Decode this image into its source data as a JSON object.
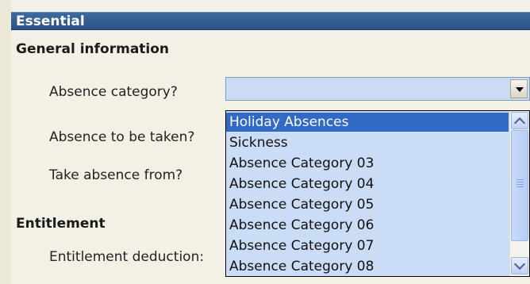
{
  "section": {
    "title": "Essential"
  },
  "general": {
    "heading": "General information",
    "fields": [
      {
        "label": "Absence category?"
      },
      {
        "label": "Absence to be taken?"
      },
      {
        "label": "Take absence from?"
      }
    ]
  },
  "entitlement": {
    "heading": "Entitlement",
    "fields": [
      {
        "label": "Entitlement deduction:"
      }
    ]
  },
  "absence_category_combo": {
    "value": "",
    "dropdown_open": true,
    "icon": "chevron-down-icon",
    "options": [
      {
        "label": "Holiday Absences",
        "selected": true
      },
      {
        "label": "Sickness",
        "selected": false
      },
      {
        "label": "Absence Category 03",
        "selected": false
      },
      {
        "label": "Absence Category 04",
        "selected": false
      },
      {
        "label": "Absence Category 05",
        "selected": false
      },
      {
        "label": "Absence Category 06",
        "selected": false
      },
      {
        "label": "Absence Category 07",
        "selected": false
      },
      {
        "label": "Absence Category 08",
        "selected": false
      }
    ]
  },
  "colors": {
    "section_bar": "#2b5286",
    "highlight": "#316ac5",
    "list_background": "#cbdcf7"
  }
}
